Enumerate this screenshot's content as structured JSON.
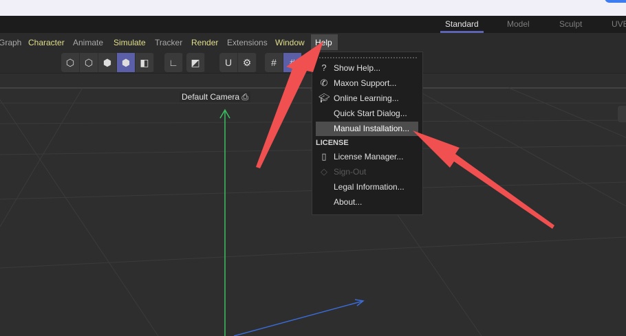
{
  "layout_tabs": [
    {
      "label": "Standard",
      "active": true
    },
    {
      "label": "Model"
    },
    {
      "label": "Sculpt"
    },
    {
      "label": "UVE"
    }
  ],
  "menubar": [
    "Graph",
    "Character",
    "Animate",
    "Simulate",
    "Tracker",
    "Render",
    "Extensions",
    "Window",
    "Help"
  ],
  "viewport": {
    "camera_label": "Default Camera"
  },
  "help_menu": {
    "items": [
      {
        "label": "Show Help...",
        "icon": "question-icon"
      },
      {
        "label": "Maxon Support...",
        "icon": "phone-icon"
      },
      {
        "label": "Online Learning...",
        "icon": "graduation-cap-icon"
      },
      {
        "label": "Quick Start Dialog..."
      },
      {
        "label": "Manual Installation...",
        "highlighted": true
      }
    ],
    "section": "LICENSE",
    "license_items": [
      {
        "label": "License Manager...",
        "icon": "license-icon"
      },
      {
        "label": "Sign-Out",
        "icon": "sign-out-icon",
        "disabled": true
      },
      {
        "label": "Legal Information..."
      },
      {
        "label": "About..."
      }
    ]
  },
  "colors": {
    "accent": "#5e64b4",
    "annotation_arrow": "#f0504f",
    "menu_highlight": "#4d4d4d"
  }
}
